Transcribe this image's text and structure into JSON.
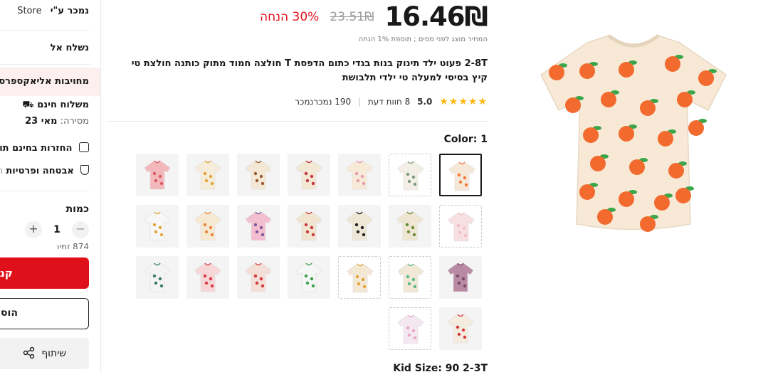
{
  "sidebar": {
    "sold_by_label": "נמכר ע\"י",
    "sold_by_store": "Store",
    "ship_to": "נשלח אל",
    "commitment": "מחויבות אליאקספרס",
    "free_shipping": "משלוח חינם",
    "delivery_label": "מסירה:",
    "delivery_date": "מאי 23",
    "free_returns": "החזרות בחינם תוך",
    "security": "אבטחה ופרטיות",
    "security_trail": "תש",
    "quantity_label": "כמות",
    "quantity_value": "1",
    "plus": "+",
    "minus": "−",
    "stock": "874 זמין",
    "buy_now": "קנ",
    "add_to_cart": "הוס",
    "share": "שיתוף"
  },
  "product": {
    "price_current": "16.46₪",
    "price_original": "23.51₪",
    "discount": "30% הנחה",
    "tax_note": "המחיר מוצג לפני מסים ; תוספת 1% הנחה",
    "title": "2-8T פעוט ילד תינוק בנות בגדי כתום הדפסת T חולצה חמוד מתוק כותנה חולצת טי קיץ בסיסי למעלה טי ילדי תלבושת",
    "stars": "★★★★★",
    "rating": "5.0",
    "reviews": "8 חוות דעת",
    "sold": "190 נמכרנמכר",
    "color_label": "Color: 1",
    "kid_size_label": "Kid Size: 90 2-3T"
  },
  "swatches": [
    {
      "name": "swatch-orange-print",
      "color": "#f6e8d8",
      "accent": "#f07a3c",
      "selected": true
    },
    {
      "name": "swatch-cream-pattern",
      "color": "#f4efe6",
      "accent": "#7a9a7a",
      "dashed": true
    },
    {
      "name": "swatch-cream-pink-letters",
      "color": "#f7ead6",
      "accent": "#e79ab0"
    },
    {
      "name": "swatch-cream-hearts",
      "color": "#f3e8d4",
      "accent": "#c8323a"
    },
    {
      "name": "swatch-cream-bear",
      "color": "#f3e8d6",
      "accent": "#9a5a32"
    },
    {
      "name": "swatch-cream-giraffe",
      "color": "#f5ecda",
      "accent": "#e2a43a"
    },
    {
      "name": "swatch-pink-trim",
      "color": "#f2b8bb",
      "accent": "#d95b62"
    },
    {
      "name": "swatch-pink-blank",
      "color": "#f7dfe2",
      "accent": "#f0c0c6",
      "dashed": true
    },
    {
      "name": "swatch-beige-print",
      "color": "#efe6d2",
      "accent": "#6b8a3a"
    },
    {
      "name": "swatch-black-trim",
      "color": "#efe7d6",
      "accent": "#222222"
    },
    {
      "name": "swatch-red-trim",
      "color": "#f1e5d1",
      "accent": "#c93a36"
    },
    {
      "name": "swatch-pink-print",
      "color": "#f3bfd0",
      "accent": "#7b5a9a"
    },
    {
      "name": "swatch-orange-trim",
      "color": "#f6e9d2",
      "accent": "#e7873a"
    },
    {
      "name": "swatch-white-print",
      "color": "#f7f7f7",
      "accent": "#e2a43a"
    },
    {
      "name": "swatch-purple",
      "color": "#b98aa3",
      "accent": "#7a4a66"
    },
    {
      "name": "swatch-green-sleeve",
      "color": "#f1e8d6",
      "accent": "#5cb88a",
      "dashed": true
    },
    {
      "name": "swatch-cream-duck",
      "color": "#f3e8d4",
      "accent": "#e2a43a",
      "dashed": true
    },
    {
      "name": "swatch-rainbow",
      "color": "#f6f6f6",
      "accent": "#3aa04a"
    },
    {
      "name": "swatch-hearts-red",
      "color": "#f3dfd6",
      "accent": "#d23a3a"
    },
    {
      "name": "swatch-strawberry",
      "color": "#f6d6d6",
      "accent": "#d83a4a"
    },
    {
      "name": "swatch-white-animals",
      "color": "#f4f4f4",
      "accent": "#3a7a6a"
    },
    {
      "name": "swatch-red-sleeve",
      "color": "#f5ece0",
      "accent": "#d73a3a"
    },
    {
      "name": "swatch-pink-sleeve",
      "color": "#f4e8f0",
      "accent": "#e6a6c6",
      "dashed": true
    }
  ],
  "colors": {
    "accent_red": "#e0101b",
    "star": "#fdb614",
    "hero_shirt": "#f7e9d6",
    "hero_orange": "#f26a2e",
    "hero_leaf": "#3aa64a"
  }
}
